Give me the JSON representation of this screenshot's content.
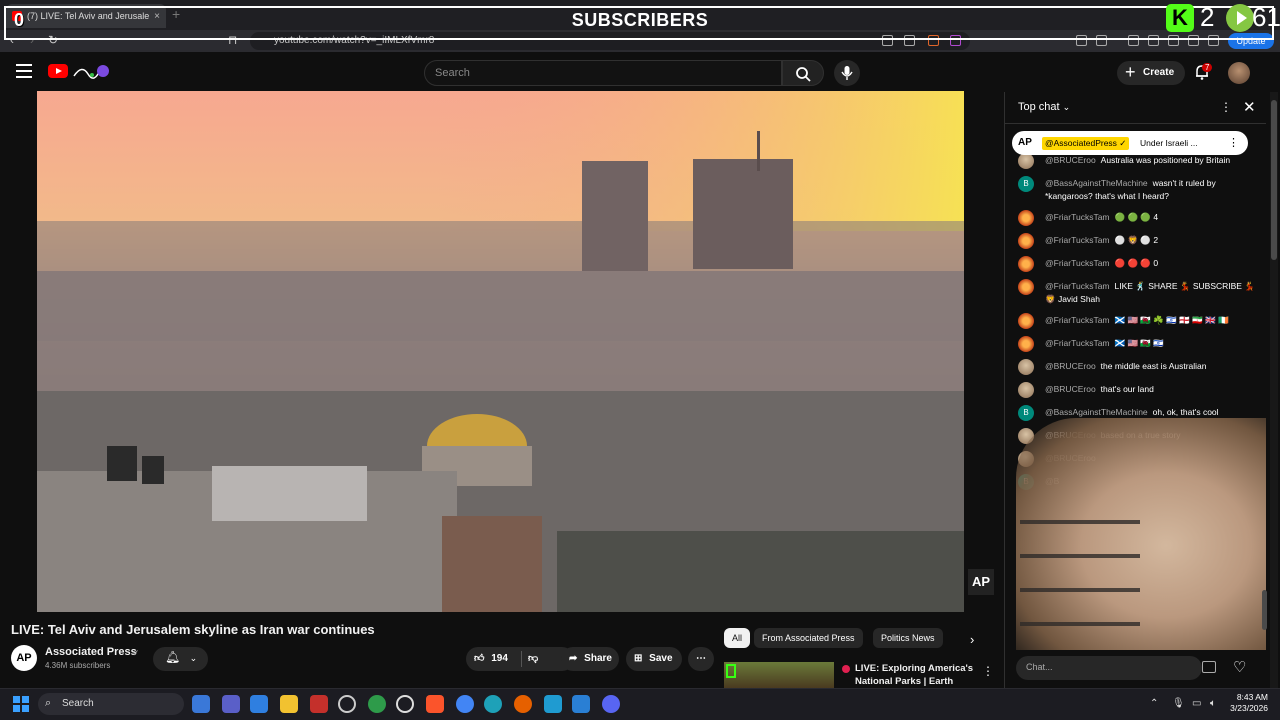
{
  "browser": {
    "tab_title": "(7) LIVE: Tel Aviv and Jerusalem",
    "tab_close": "×",
    "new_tab": "+",
    "url": "youtube.com/watch?v=_iIMLXfVmr8",
    "update_label": "Update"
  },
  "overlay": {
    "title": "SUBSCRIBERS",
    "left_count": "0",
    "kick_logo": "K",
    "kick_count": "2",
    "rumble_count": "61"
  },
  "header": {
    "search_placeholder": "Search",
    "create_label": "Create",
    "notification_count": "7"
  },
  "video": {
    "title": "LIVE: Tel Aviv and Jerusalem skyline as Iran war continues",
    "watermark": "AP",
    "channel": {
      "avatar_text": "AP",
      "name": "Associated Press",
      "verified": "✓",
      "subscribers": "4.36M subscribers"
    },
    "actions": {
      "likes": "194",
      "share": "Share",
      "save": "Save"
    }
  },
  "chips": [
    "All",
    "From Associated Press",
    "Politics News"
  ],
  "recommendation": {
    "title": "LIVE: Exploring America's National Parks | Earth Month ..."
  },
  "chat": {
    "mode": "Top chat",
    "pinned": {
      "avatar": "AP",
      "author": "@AssociatedPress ✓",
      "text": "Under Israeli ..."
    },
    "messages": [
      {
        "author": "@BRUCEroo",
        "text": "Australia was positioned by Britain",
        "avatar": "bru",
        "initial": ""
      },
      {
        "author": "@BassAgainstTheMachine",
        "text": "wasn't it ruled by *kangaroos? that's what I heard?",
        "avatar": "bat",
        "initial": "B"
      },
      {
        "author": "@FriarTucksTam",
        "text": "🟢 🟢 🟢 4",
        "avatar": "ftt",
        "initial": ""
      },
      {
        "author": "@FriarTucksTam",
        "text": "⚪ 🦁 ⚪ 2",
        "avatar": "ftt",
        "initial": ""
      },
      {
        "author": "@FriarTucksTam",
        "text": "🔴 🔴 🔴 0",
        "avatar": "ftt",
        "initial": ""
      },
      {
        "author": "@FriarTucksTam",
        "text": "LIKE 🕺 SHARE 💃 SUBSCRIBE 💃 🦁 Javid Shah",
        "avatar": "ftt",
        "initial": ""
      },
      {
        "author": "@FriarTucksTam",
        "text": "🏴󠁧󠁢󠁳󠁣󠁴󠁿 🇺🇸 🏴󠁧󠁢󠁷󠁬󠁳󠁿 ☘️ 🇮🇱 🏴󠁧󠁢󠁥󠁮󠁧󠁿 🇮🇷 🇬🇧 🇮🇪",
        "avatar": "ftt",
        "initial": ""
      },
      {
        "author": "@FriarTucksTam",
        "text": "🏴󠁧󠁢󠁳󠁣󠁴󠁿 🇺🇸 🏴󠁧󠁢󠁷󠁬󠁳󠁿 🇮🇱",
        "avatar": "ftt",
        "initial": ""
      },
      {
        "author": "@BRUCEroo",
        "text": "the middle east is Australian",
        "avatar": "bru",
        "initial": ""
      },
      {
        "author": "@BRUCEroo",
        "text": "that's our land",
        "avatar": "bru",
        "initial": ""
      },
      {
        "author": "@BassAgainstTheMachine",
        "text": "oh, ok, that's cool",
        "avatar": "bat",
        "initial": "B"
      },
      {
        "author": "@BRUCEroo",
        "text": "based on a true story",
        "avatar": "bru",
        "initial": ""
      },
      {
        "author": "@BRUCEroo",
        "text": "",
        "avatar": "bru",
        "initial": ""
      },
      {
        "author": "@B",
        "text": "",
        "avatar": "bat",
        "initial": "B"
      }
    ],
    "input_placeholder": "Chat..."
  },
  "taskbar": {
    "search_label": "Search",
    "time": "8:43 AM",
    "date": "3/23/2026"
  }
}
